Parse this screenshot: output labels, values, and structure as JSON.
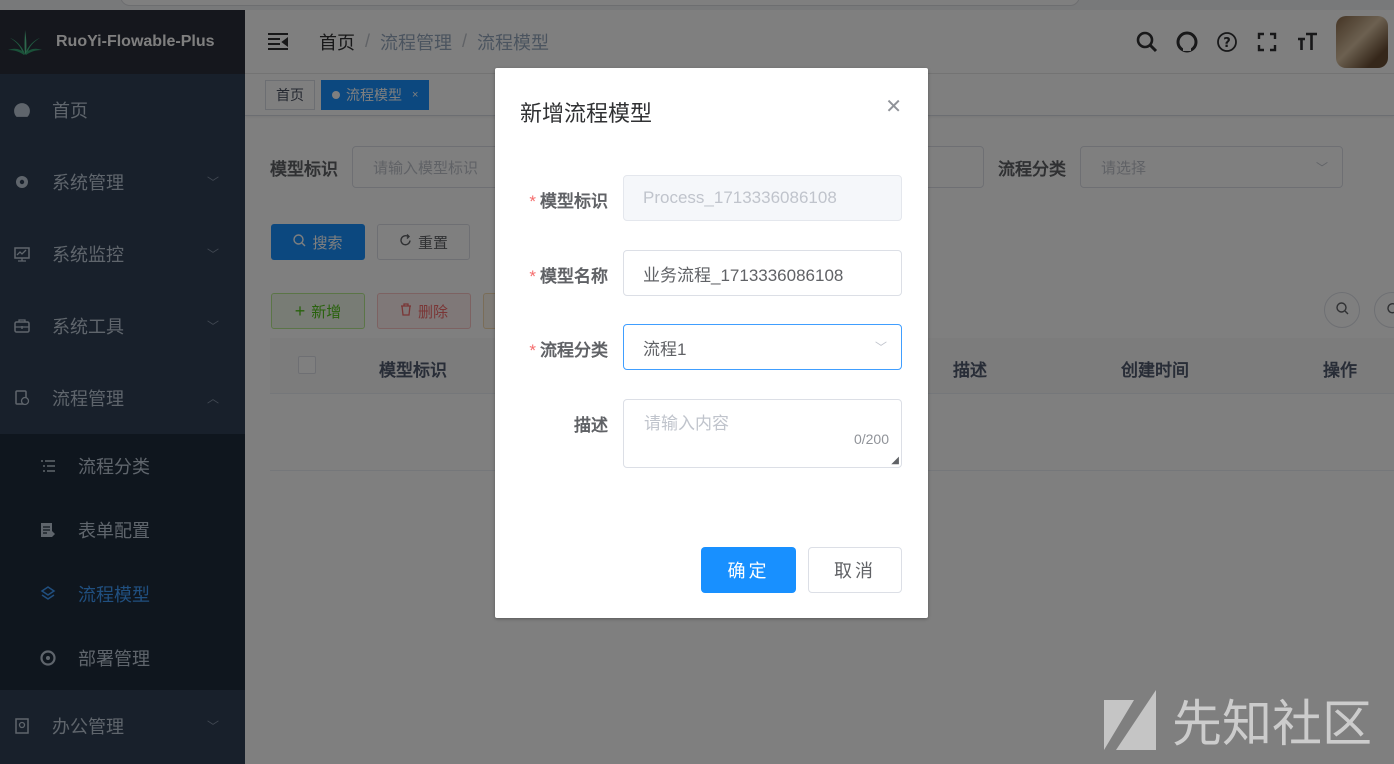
{
  "app": {
    "title": "RuoYi-Flowable-Plus"
  },
  "sidebar": {
    "items": [
      {
        "label": "首页",
        "icon": "dashboard-icon",
        "expandable": false
      },
      {
        "label": "系统管理",
        "icon": "gear-icon",
        "expandable": true
      },
      {
        "label": "系统监控",
        "icon": "monitor-icon",
        "expandable": true
      },
      {
        "label": "系统工具",
        "icon": "toolbox-icon",
        "expandable": true
      },
      {
        "label": "流程管理",
        "icon": "workflow-icon",
        "expandable": true,
        "expanded": true
      }
    ],
    "sub_items": [
      {
        "label": "流程分类",
        "icon": "list-icon"
      },
      {
        "label": "表单配置",
        "icon": "form-icon"
      },
      {
        "label": "流程模型",
        "icon": "model-icon",
        "active": true
      },
      {
        "label": "部署管理",
        "icon": "deploy-icon"
      }
    ],
    "bottom_item": {
      "label": "办公管理",
      "icon": "office-icon"
    }
  },
  "navbar": {
    "breadcrumb": [
      "首页",
      "流程管理",
      "流程模型"
    ],
    "icons": [
      "search-icon",
      "github-icon",
      "help-icon",
      "fullscreen-icon",
      "font-size-icon"
    ]
  },
  "tags": {
    "home": "首页",
    "active": "流程模型"
  },
  "search": {
    "model_key_label": "模型标识",
    "model_key_placeholder": "请输入模型标识",
    "category_label": "流程分类",
    "category_placeholder": "请选择",
    "search_button": "搜索",
    "reset_button": "重置"
  },
  "toolbar": {
    "add_button": "新增",
    "delete_button": "删除"
  },
  "table": {
    "columns": [
      "模型标识",
      "描述",
      "创建时间",
      "操作"
    ]
  },
  "dialog": {
    "title": "新增流程模型",
    "fields": {
      "model_key": {
        "label": "模型标识",
        "value": "Process_1713336086108",
        "disabled": true
      },
      "model_name": {
        "label": "模型名称",
        "value": "业务流程_1713336086108"
      },
      "category": {
        "label": "流程分类",
        "value": "流程1"
      },
      "description": {
        "label": "描述",
        "placeholder": "请输入内容",
        "counter": "0/200"
      }
    },
    "confirm_button": "确定",
    "cancel_button": "取消"
  },
  "watermark": {
    "text": "先知社区"
  },
  "colors": {
    "primary": "#1890ff",
    "sidebar_bg": "#304156",
    "sidebar_active": "#409eff",
    "required": "#f56c6c"
  }
}
